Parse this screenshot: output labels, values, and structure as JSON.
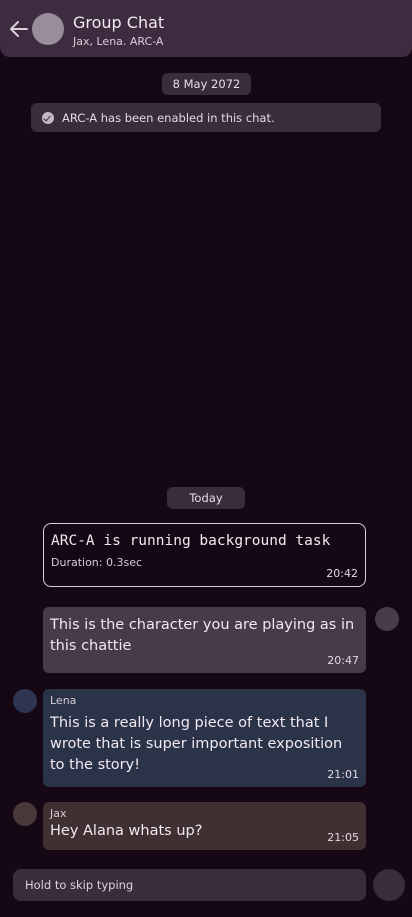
{
  "header": {
    "title": "Group Chat",
    "subtitle": "Jax, Lena. ARC-A"
  },
  "dates": {
    "first": "8 May 2072",
    "today": "Today"
  },
  "system_notice": "ARC-A has been enabled in this chat.",
  "task": {
    "title": "ARC-A is running background task",
    "duration": "Duration: 0.3sec",
    "time": "20:42"
  },
  "messages": [
    {
      "sender": "",
      "text": "This is the character you are playing as in this chattie",
      "time": "20:47"
    },
    {
      "sender": "Lena",
      "text": "This is a really long piece of text that I wrote that is super important exposition to the story!",
      "time": "21:01"
    },
    {
      "sender": "Jax",
      "text": "Hey Alana whats up?",
      "time": "21:05"
    }
  ],
  "input": {
    "placeholder": "Hold to skip typing"
  },
  "colors": {
    "background": "#150714",
    "header": "#3d2b3f",
    "self_bubble": "#473a4b",
    "lena_bubble": "#2b3349",
    "jax_bubble": "#3f3032"
  }
}
